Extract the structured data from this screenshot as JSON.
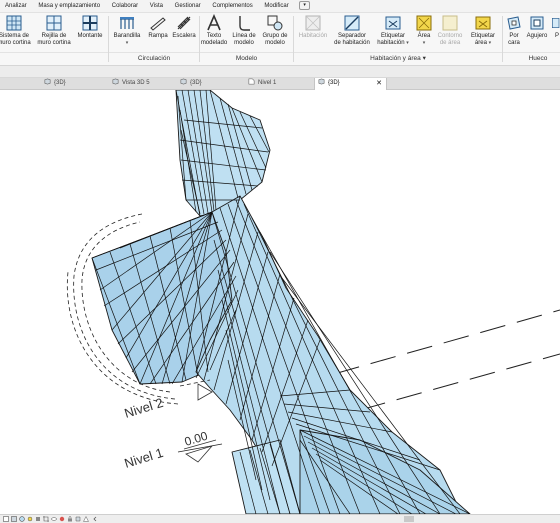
{
  "menu": {
    "items": [
      "Analizar",
      "Masa y emplazamiento",
      "Colaborar",
      "Vista",
      "Gestionar",
      "Complementos",
      "Modificar"
    ],
    "dropdown": "▾"
  },
  "ribbon": {
    "tools": {
      "curtain_system": "Sistema de\nmuro cortina",
      "curtain_grid": "Rejilla de\nmuro cortina",
      "mullion": "Montante",
      "railing": "Barandilla",
      "ramp": "Rampa",
      "stair": "Escalera",
      "model_text": "Texto\nmodelado",
      "model_line": "Línea de\nmodelo",
      "model_group": "Grupo de\nmodelo",
      "room": "Habitación",
      "room_separator": "Separador\nde habitación",
      "tag_room": "Etiquetar\nhabitación",
      "area": "Área",
      "area_boundary": "Contorno\nde área",
      "tag_area": "Etiquetar\nárea",
      "by_face": "Por\ncara",
      "shaft": "Agujero",
      "shaft_extra": "P"
    },
    "panels": {
      "circulation": "Circulación",
      "model": "Modelo",
      "room_area": "Habitación y área",
      "room_area_caret": "▾",
      "opening": "Hueco"
    }
  },
  "tabs": [
    {
      "label": "{3D}",
      "active": false
    },
    {
      "label": "Vista 3D 5",
      "active": false
    },
    {
      "label": "{3D}",
      "active": false
    },
    {
      "label": "Nivel 1",
      "active": false
    },
    {
      "label": "{3D}",
      "active": true
    }
  ],
  "tab_close": "✕",
  "canvas": {
    "levels": [
      {
        "name": "Nivel 2",
        "value": ""
      },
      {
        "name": "Nivel 1",
        "value": "0.00"
      }
    ]
  },
  "colors": {
    "surface_fill": "#b9dcef",
    "edge": "#1a1a1a",
    "accent_blue": "#1f5fa8",
    "area_yellow": "#f2d64b"
  }
}
